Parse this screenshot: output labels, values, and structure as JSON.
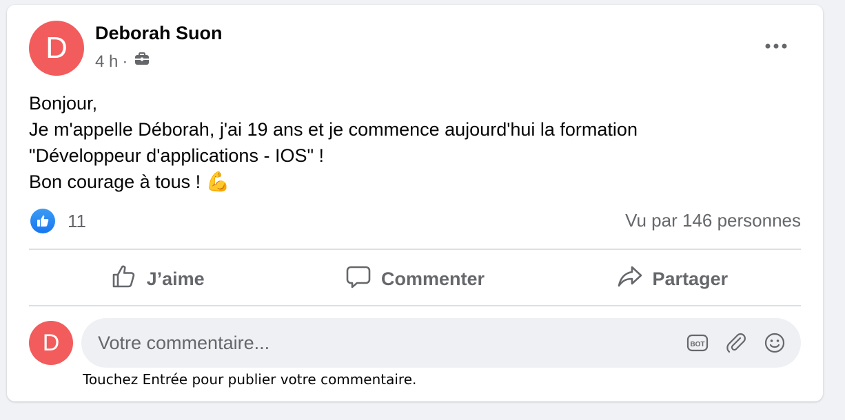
{
  "post": {
    "avatar_letter": "D",
    "avatar_color": "#f25c5c",
    "author": "Deborah Suon",
    "time": "4 h",
    "separator": "·",
    "visibility_icon": "briefcase-icon",
    "lines": [
      "Bonjour,",
      "Je m'appelle Déborah, j'ai 19 ans et je commence aujourd'hui la formation",
      "\"Développeur d'applications - IOS\" !",
      "Bon courage à tous !"
    ],
    "emoji": "💪",
    "reaction_icon": "thumbs-up-icon",
    "reaction_count": "11",
    "views": "Vu par 146 personnes"
  },
  "actions": {
    "like_label": "J’aime",
    "comment_label": "Commenter",
    "share_label": "Partager"
  },
  "comment": {
    "avatar_letter": "D",
    "placeholder": "Votre commentaire...",
    "hint": "Touchez Entrée pour publier votre commentaire.",
    "icons": [
      "bot-icon",
      "paperclip-icon",
      "smiley-icon"
    ]
  },
  "colors": {
    "accent": "#1877f2",
    "avatar": "#f25c5c",
    "muted_text": "#65676b"
  }
}
